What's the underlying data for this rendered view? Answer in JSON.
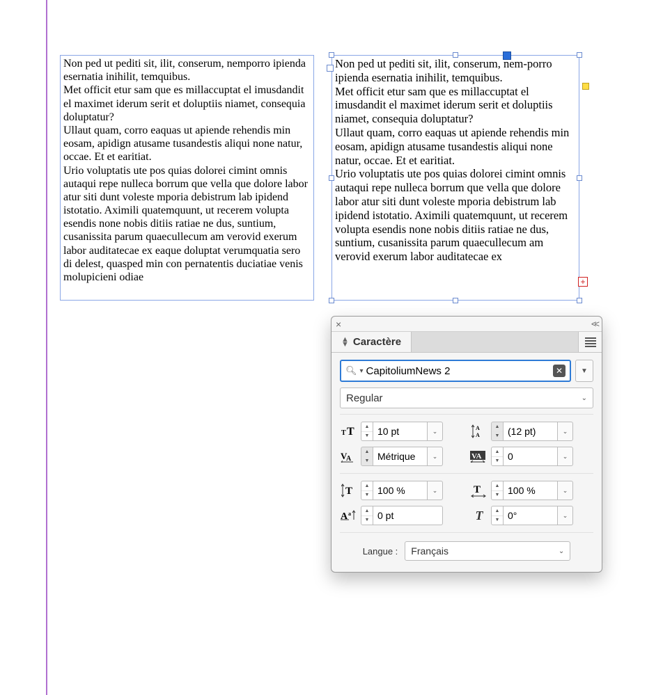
{
  "frames": {
    "left_text": "Non ped ut pediti sit, ilit, conserum, nemporro ipienda esernatia inihilit, temquibus.\nMet officit etur sam que es millaccuptat el imusdandit el maximet iderum serit et doluptiis niamet, consequia doluptatur?\nUllaut quam, corro eaquas ut apiende rehendis min eosam, apidign atusame tusandestis aliqui none natur, occae. Et et earitiat.\nUrio voluptatis ute pos quias dolorei cimint omnis autaqui repe nulleca borrum que vella que dolore labor atur siti dunt voleste mporia debistrum lab ipidend istotatio. Aximili quatemquunt, ut recerem volupta esendis none nobis ditiis ratiae ne dus, suntium, cusanissita parum quaecullecum am verovid exerum labor auditatecae ex eaque doluptat verumquatia sero di delest, quasped min con pernatentis duciatiae venis molupicieni odiae",
    "right_text": "Non ped ut pediti sit, ilit, conserum, nem-porro ipienda esernatia inihilit, temquibus.\nMet officit etur sam que es millaccuptat el imusdandit el maximet iderum serit et doluptiis niamet, consequia doluptatur?\nUllaut quam, corro eaquas ut apiende rehendis min eosam, apidign atusame tusandestis aliqui none natur, occae. Et et earitiat.\nUrio voluptatis ute pos quias dolorei cimint omnis autaqui repe nulleca borrum que vella que dolore labor atur siti dunt voleste mporia debistrum lab ipidend istotatio. Aximili quatemquunt, ut recerem volupta esendis none nobis ditiis ratiae ne dus, suntium, cusanissita parum quaecullecum am verovid exerum labor auditatecae ex",
    "overset_marker": "+"
  },
  "panel": {
    "title": "Caractère",
    "font_family": "CapitoliumNews 2",
    "font_style": "Regular",
    "font_size": "10 pt",
    "leading": "(12 pt)",
    "kerning": "Métrique",
    "tracking": "0",
    "vscale": "100 %",
    "hscale": "100 %",
    "baseline": "0 pt",
    "skew": "0°",
    "language_label": "Langue :",
    "language_value": "Français"
  }
}
